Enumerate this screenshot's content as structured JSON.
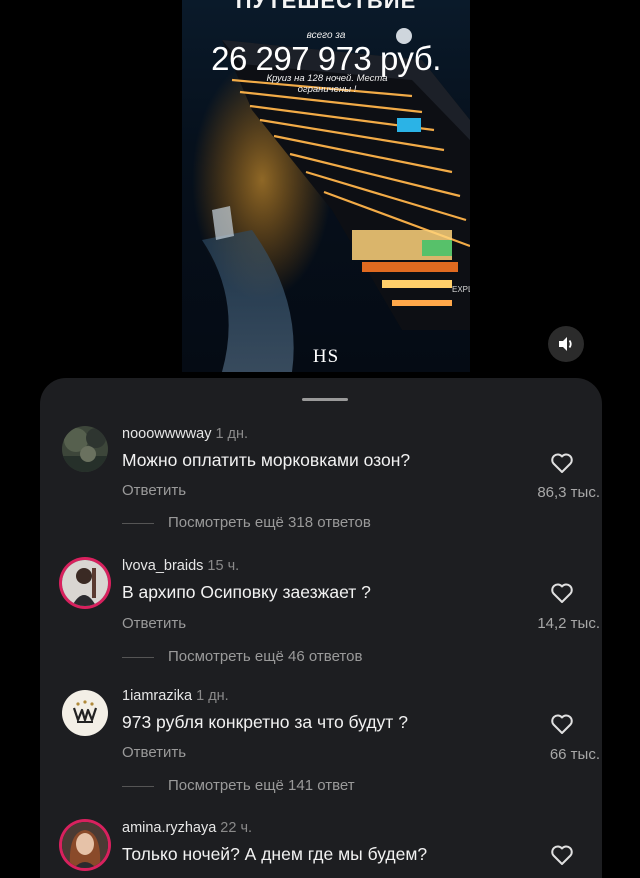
{
  "video": {
    "title_top": "ПУТЕШЕСТВИЕ",
    "small_prefix": "всего за",
    "price": "26 297 973 руб.",
    "subtitle": "Круиз на 128 ночей. Места ограничены !",
    "brand": "HS",
    "ship_marking": "EXPL"
  },
  "sound_button": {
    "icon": "speaker-icon"
  },
  "comments": [
    {
      "username": "nooowwwway",
      "time": "1 дн.",
      "text": "Можно оплатить морковками озон?",
      "reply_label": "Ответить",
      "likes": "86,3 тыс.",
      "more_replies": "Посмотреть ещё 318 ответов"
    },
    {
      "username": "lvova_braids",
      "time": "15 ч.",
      "text": "В архипо Осиповку заезжает ?",
      "reply_label": "Ответить",
      "likes": "14,2 тыс.",
      "more_replies": "Посмотреть ещё 46 ответов"
    },
    {
      "username": "1iamrazika",
      "time": "1 дн.",
      "text": "973 рубля конкретно за что будут ?",
      "reply_label": "Ответить",
      "likes": "66 тыс.",
      "more_replies": "Посмотреть ещё 141 ответ"
    },
    {
      "username": "amina.ryzhaya",
      "time": "22 ч.",
      "text": "Только ночей? А днем где мы будем?"
    }
  ],
  "colors": {
    "sheet_bg": "#1d1e21",
    "story_ring": "#d8215e",
    "muted_text": "#9a9a9a"
  }
}
